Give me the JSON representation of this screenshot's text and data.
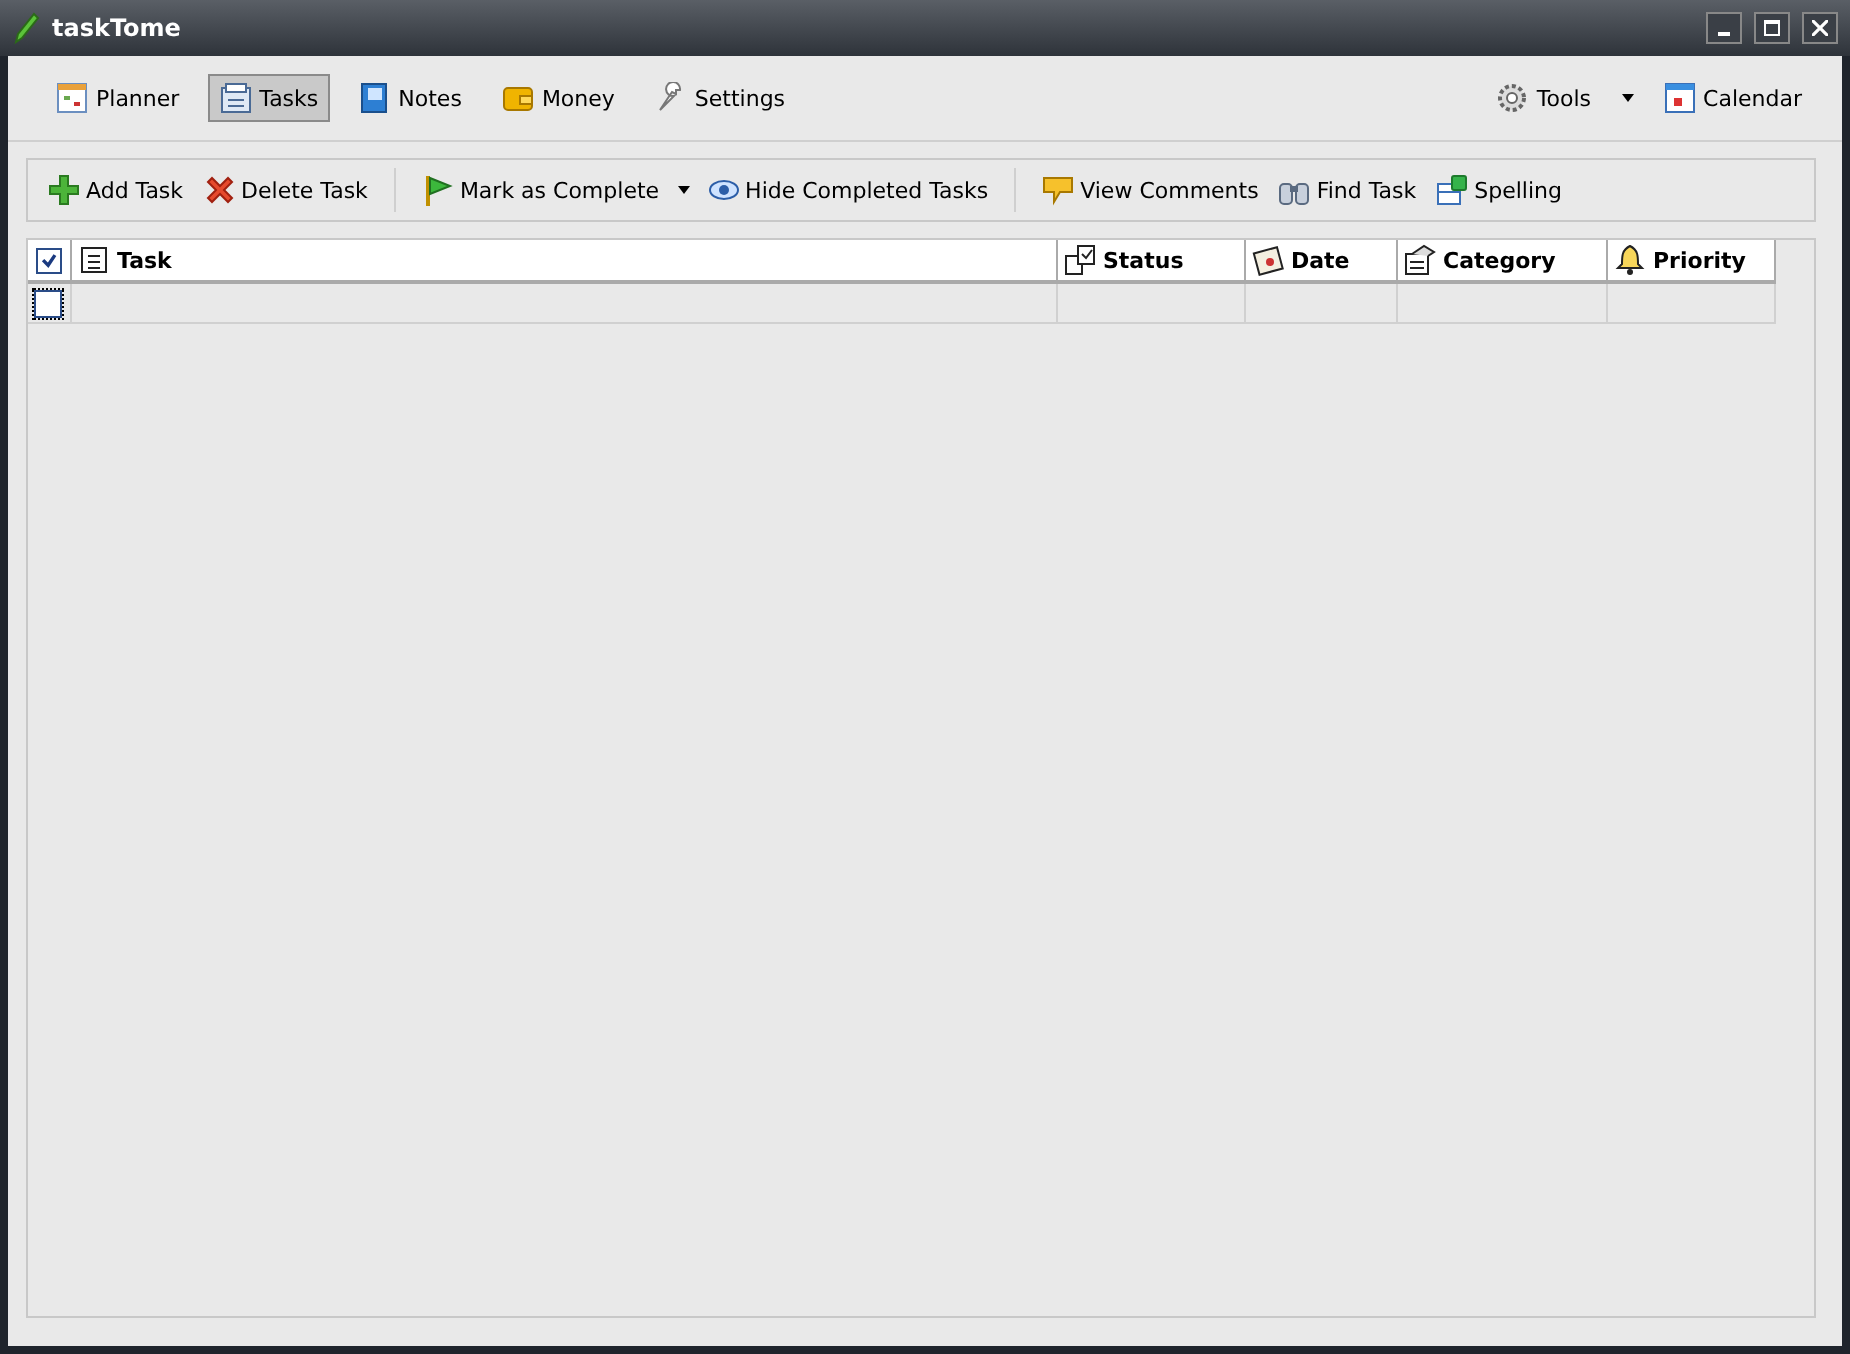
{
  "window": {
    "title": "taskTome"
  },
  "nav": [
    {
      "label": "Planner",
      "selected": false
    },
    {
      "label": "Tasks",
      "selected": true
    },
    {
      "label": "Notes",
      "selected": false
    },
    {
      "label": "Money",
      "selected": false
    },
    {
      "label": "Settings",
      "selected": false
    }
  ],
  "nav_right": [
    {
      "label": "Tools"
    },
    {
      "label": "Calendar"
    }
  ],
  "toolbar": [
    {
      "kind": "button",
      "label": "Add Task"
    },
    {
      "kind": "button",
      "label": "Delete Task"
    },
    {
      "kind": "separator"
    },
    {
      "kind": "split",
      "label": "Mark as Complete"
    },
    {
      "kind": "button",
      "label": "Hide Completed Tasks"
    },
    {
      "kind": "separator"
    },
    {
      "kind": "button",
      "label": "View Comments"
    },
    {
      "kind": "button",
      "label": "Find Task"
    },
    {
      "kind": "button",
      "label": "Spelling"
    }
  ],
  "table": {
    "header_checked": true,
    "columns": [
      {
        "label": "Task"
      },
      {
        "label": "Status"
      },
      {
        "label": "Date"
      },
      {
        "label": "Category"
      },
      {
        "label": "Priority"
      }
    ],
    "rows": [
      {
        "checked": false,
        "cells": [
          "",
          "",
          "",
          "",
          ""
        ]
      }
    ]
  }
}
